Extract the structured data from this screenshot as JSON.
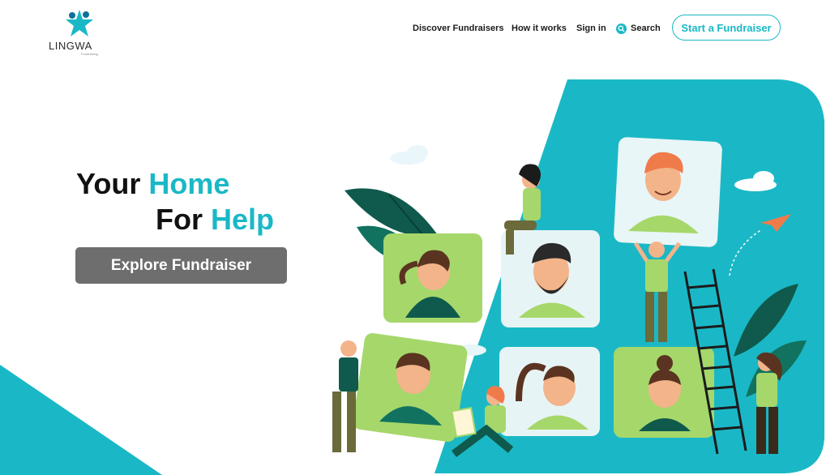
{
  "brand": {
    "name": "LINGWA",
    "tagline": "Fundraising"
  },
  "nav": {
    "discover": "Discover Fundraisers",
    "how": "How it works",
    "signin": "Sign in",
    "search": "Search",
    "cta": "Start a Fundraiser"
  },
  "hero": {
    "line1_a": "Your",
    "line1_b": "Home",
    "line2_a": "For",
    "line2_b": "Help",
    "button": "Explore Fundraiser"
  },
  "colors": {
    "accent": "#1ab8c6",
    "tile": "#a6d76b",
    "button_bg": "#6e6e6e",
    "leaf_dark": "#0f5a4c"
  }
}
